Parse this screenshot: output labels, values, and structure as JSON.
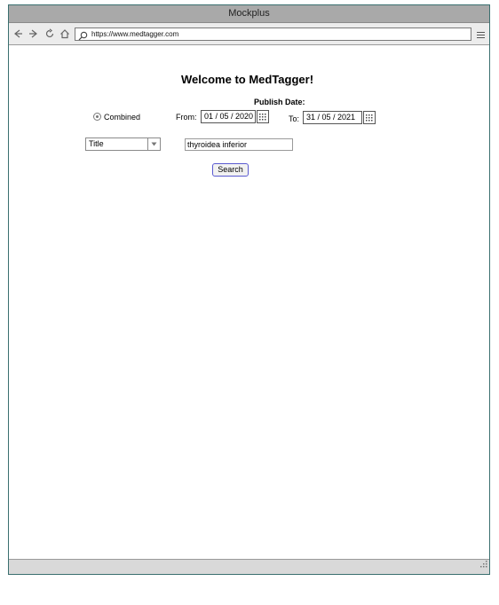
{
  "window": {
    "title": "Mockplus"
  },
  "browser": {
    "url": "https://www.medtagger.com",
    "icons": [
      "back-icon",
      "forward-icon",
      "refresh-icon",
      "home-icon",
      "search-icon",
      "menu-icon",
      "resize-grip-icon"
    ]
  },
  "page": {
    "heading": "Welcome to MedTagger!",
    "publish_date_label": "Publish Date:",
    "radio_label": "Combined",
    "from_label": "From:",
    "from_date": "01 / 05 / 2020",
    "to_label": "To:",
    "to_date": "31 / 05 / 2021",
    "field_select_value": "Title",
    "query_value": "thyroidea inferior",
    "search_button": "Search"
  },
  "colors": {
    "titlebar": "#a9a9a9",
    "toolbar": "#ececec",
    "statusbar": "#d9d9d9",
    "window_border": "#3a6f6f",
    "button_border": "#5a5ad0"
  }
}
